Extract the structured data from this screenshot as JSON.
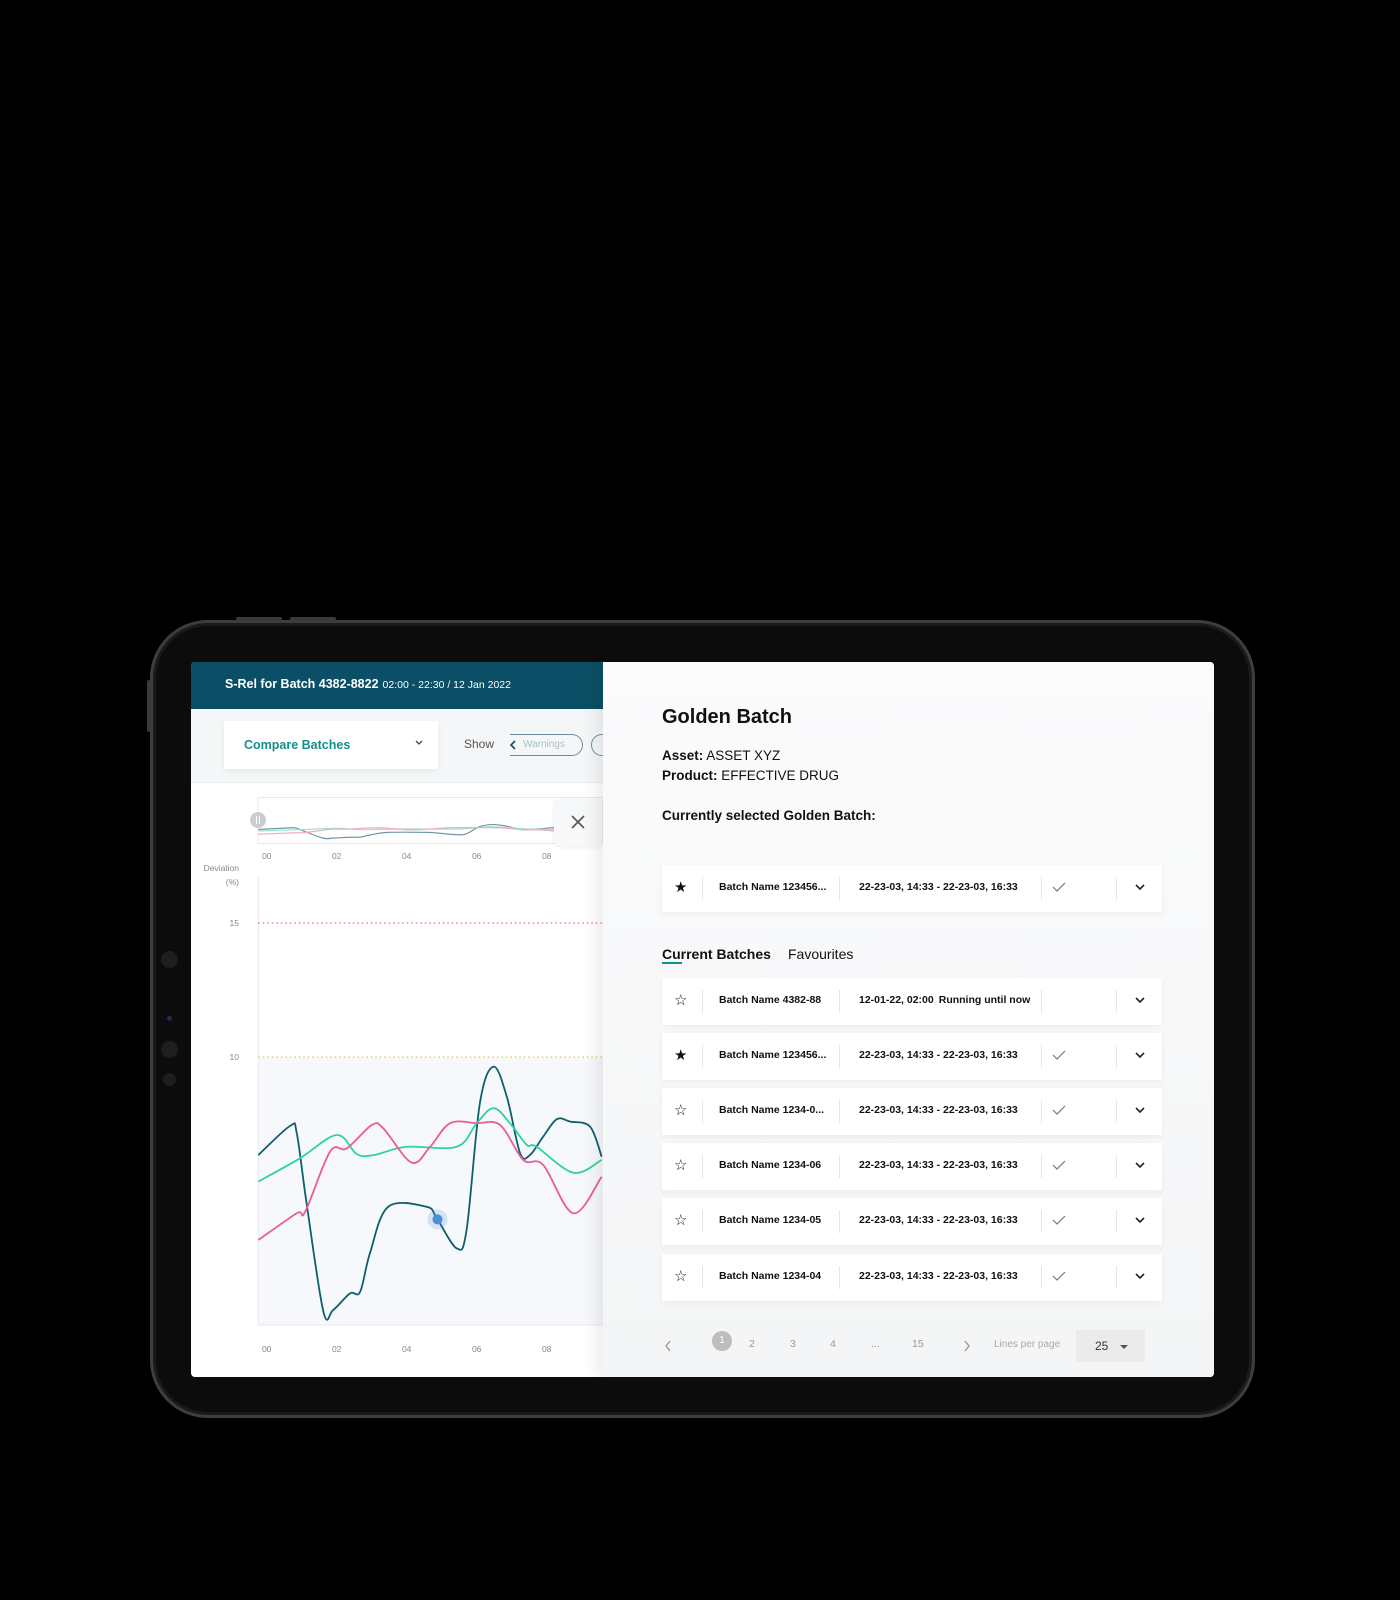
{
  "header": {
    "title": "S-Rel for Batch 4382-8822",
    "subtitle": "02:00 - 22:30 / 12 Jan 2022"
  },
  "toolbar": {
    "compare_label": "Compare Batches",
    "show_label": "Show",
    "warnings_label": "Warnings"
  },
  "colors": {
    "header": "#0b4f66",
    "accent": "#13908f",
    "series_dark": "#0e5f6e",
    "series_green": "#2ed39a",
    "series_pink": "#ea5b9a",
    "threshold_red": "#ef6b6b",
    "threshold_yellow": "#e3c35b",
    "marker": "#4a90d9"
  },
  "chart_data": {
    "type": "line",
    "ylabel_line1": "Deviation",
    "ylabel_line2": "(%)",
    "ylim": [
      0,
      16.7
    ],
    "xlim": [
      -0.24,
      9.6
    ],
    "yticks": [
      "15",
      "10"
    ],
    "xticks": [
      "00",
      "02",
      "04",
      "06",
      "08"
    ],
    "thresholds": [
      {
        "value": 15,
        "color": "red"
      },
      {
        "value": 10,
        "color": "yellow"
      }
    ],
    "grid": false,
    "series": [
      {
        "points": [
          [
            -0.24,
            6.34
          ],
          [
            0.67,
            7.43
          ],
          [
            0.86,
            7.15
          ],
          [
            1.14,
            4.54
          ],
          [
            1.62,
            0.5
          ],
          [
            1.9,
            0.56
          ],
          [
            2.38,
            1.18
          ],
          [
            2.67,
            1.24
          ],
          [
            2.95,
            2.68
          ],
          [
            3.47,
            4.41
          ],
          [
            4.57,
            4.41
          ],
          [
            4.86,
            3.98
          ],
          [
            5.43,
            2.86
          ],
          [
            5.71,
            3.54
          ],
          [
            6.09,
            8.27
          ],
          [
            6.48,
            9.64
          ],
          [
            6.86,
            8.52
          ],
          [
            7.24,
            6.41
          ],
          [
            7.52,
            6.34
          ],
          [
            7.9,
            7.03
          ],
          [
            8.29,
            7.68
          ],
          [
            8.67,
            7.59
          ],
          [
            9.24,
            7.4
          ],
          [
            9.57,
            6.28
          ]
        ]
      },
      {
        "points": [
          [
            -0.24,
            5.35
          ],
          [
            0.95,
            6.22
          ],
          [
            2.0,
            7.09
          ],
          [
            2.57,
            6.38
          ],
          [
            3.05,
            6.34
          ],
          [
            4.0,
            6.65
          ],
          [
            5.43,
            6.65
          ],
          [
            6.0,
            7.53
          ],
          [
            6.48,
            8.09
          ],
          [
            6.95,
            7.53
          ],
          [
            7.43,
            6.72
          ],
          [
            7.71,
            6.65
          ],
          [
            8.76,
            5.68
          ],
          [
            9.57,
            6.16
          ]
        ]
      },
      {
        "points": [
          [
            -0.24,
            3.17
          ],
          [
            0.86,
            4.17
          ],
          [
            1.1,
            4.23
          ],
          [
            1.81,
            6.47
          ],
          [
            2.29,
            6.59
          ],
          [
            3.0,
            7.46
          ],
          [
            3.33,
            7.34
          ],
          [
            4.14,
            6.06
          ],
          [
            4.67,
            6.65
          ],
          [
            5.24,
            7.53
          ],
          [
            6.0,
            7.53
          ],
          [
            6.67,
            7.46
          ],
          [
            7.33,
            6.16
          ],
          [
            7.9,
            5.97
          ],
          [
            8.76,
            4.17
          ],
          [
            9.57,
            5.53
          ]
        ]
      }
    ],
    "highlight_point": [
      4.88,
      3.94
    ]
  },
  "minichart": {
    "xticks": [
      "00",
      "02",
      "04",
      "06",
      "08"
    ]
  },
  "panel": {
    "title": "Golden Batch",
    "asset_label": "Asset:",
    "asset_value": "ASSET XYZ",
    "product_label": "Product:",
    "product_value": "EFFECTIVE DRUG",
    "selected_label": "Currently selected Golden Batch:",
    "golden": {
      "favourite": true,
      "name": "Batch Name 123456...",
      "date": "22-23-03, 14:33 - 22-23-03, 16:33",
      "checked": true
    },
    "tabs": [
      {
        "label": "Current Batches",
        "active": true
      },
      {
        "label": "Favourites",
        "active": false
      }
    ],
    "rows": [
      {
        "favourite": false,
        "name": "Batch Name 4382-88",
        "date": "12-01-22, 02:00",
        "status": "Running until now",
        "checked": false
      },
      {
        "favourite": true,
        "name": "Batch Name 123456...",
        "date": "22-23-03, 14:33 - 22-23-03, 16:33",
        "checked": true
      },
      {
        "favourite": false,
        "name": "Batch Name 1234-0...",
        "date": "22-23-03, 14:33 - 22-23-03, 16:33",
        "checked": true
      },
      {
        "favourite": false,
        "name": "Batch Name 1234-06",
        "date": "22-23-03, 14:33 - 22-23-03, 16:33",
        "checked": true
      },
      {
        "favourite": false,
        "name": "Batch Name 1234-05",
        "date": "22-23-03, 14:33 - 22-23-03, 16:33",
        "checked": true
      },
      {
        "favourite": false,
        "name": "Batch Name 1234-04",
        "date": "22-23-03, 14:33 - 22-23-03, 16:33",
        "checked": true
      }
    ],
    "pagination": {
      "pages": [
        "1",
        "2",
        "3",
        "4",
        "...",
        "15"
      ],
      "current": "1",
      "lines_label": "Lines per page",
      "lines_value": "25"
    }
  }
}
